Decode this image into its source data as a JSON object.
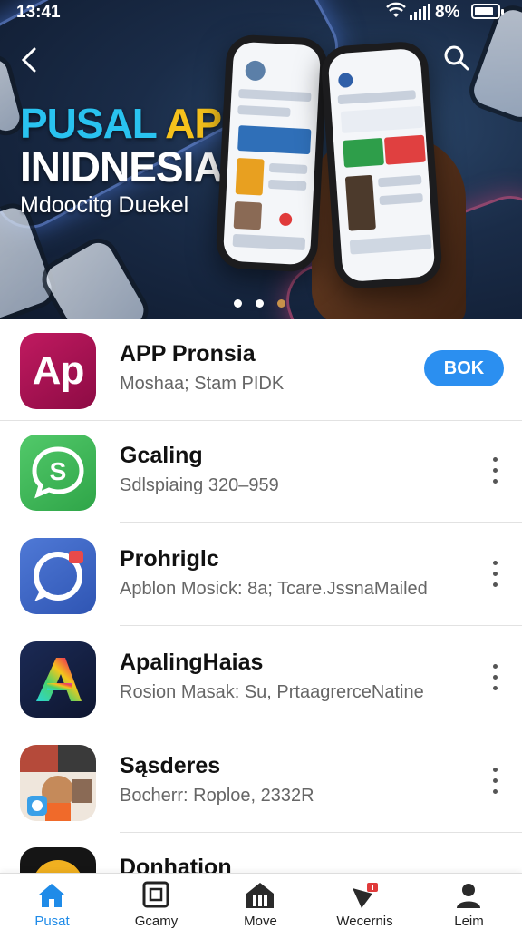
{
  "status_bar": {
    "time": "13:41",
    "battery": "8%"
  },
  "hero": {
    "title_line1_part1": "PUSAL ",
    "title_line1_part2": "APR",
    "title_line2": "INIDNESIA",
    "subtitle": "Mdoocitg Duekel",
    "carousel_pages": 3,
    "carousel_active": 3,
    "colors": {
      "title": "#29c3f0",
      "accent": "#f6c21c"
    }
  },
  "apps": [
    {
      "name": "APP Pronsia",
      "subtitle": "Moshaa; Stam PIDK",
      "icon": "ap-icon",
      "icon_text": "Ap",
      "action": "BOK"
    },
    {
      "name": "Gcaling",
      "subtitle": "Sdlspiaing 320–959",
      "icon": "chat-s-icon"
    },
    {
      "name": "Prohriglc",
      "subtitle": "Apblon Mosick: 8a; Tcare.JssnaMailed",
      "icon": "message-ring-icon"
    },
    {
      "name": "ApalingHaias",
      "subtitle": "Rosion Masak: Su, PrtaagrerceNatine",
      "icon": "rainbow-a-icon"
    },
    {
      "name": "Sąsderes",
      "subtitle": "Bocherr: Roploe, 2332R",
      "icon": "photo-collage-icon"
    },
    {
      "name": "Donhation",
      "subtitle": "",
      "icon": "circle-icon"
    }
  ],
  "bottom_nav": [
    {
      "label": "Pusat",
      "icon": "home-icon",
      "active": true
    },
    {
      "label": "Gcamy",
      "icon": "square-frame-icon",
      "active": false
    },
    {
      "label": "Move",
      "icon": "house-columns-icon",
      "active": false
    },
    {
      "label": "Wecernis",
      "icon": "flag-notification-icon",
      "active": false
    },
    {
      "label": "Leim",
      "icon": "profile-icon",
      "active": false
    }
  ],
  "colors": {
    "action_button": "#2b8ff0",
    "active_tab": "#1f8be8"
  }
}
